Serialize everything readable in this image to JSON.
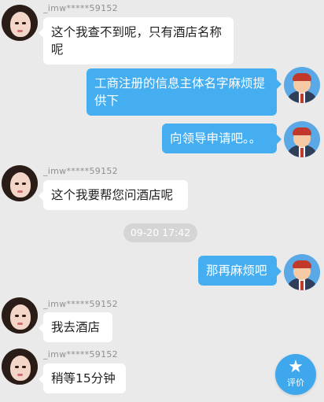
{
  "colors": {
    "background": "#eaeaea",
    "agent_bubble": "#45aef0",
    "customer_bubble": "#ffffff",
    "fab": "#3fa7eb"
  },
  "messages": [
    {
      "sender": "customer",
      "name": "_imw*****59152",
      "text": "这个我查不到呢，只有酒店名称呢"
    },
    {
      "sender": "agent",
      "text": "工商注册的信息主体名字麻烦提供下"
    },
    {
      "sender": "agent",
      "text": "向领导申请吧。。"
    },
    {
      "sender": "customer",
      "name": "_imw*****59152",
      "text": "这个我要帮您问酒店呢"
    },
    {
      "sender": "system",
      "text": "09-20 17:42"
    },
    {
      "sender": "agent",
      "text": "那再麻烦吧"
    },
    {
      "sender": "customer",
      "name": "_imw*****59152",
      "text": "我去酒店"
    },
    {
      "sender": "customer",
      "name": "_imw*****59152",
      "text": "稍等15分钟"
    }
  ],
  "rate_button": {
    "icon": "star-icon",
    "label": "评价"
  }
}
